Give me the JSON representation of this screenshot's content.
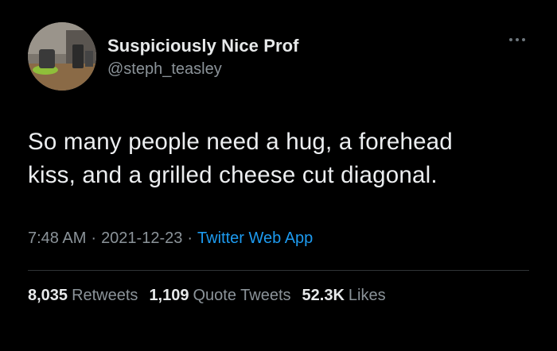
{
  "author": {
    "display_name": "Suspiciously Nice Prof",
    "handle": "@steph_teasley"
  },
  "tweet": {
    "text_lines": [
      "So many people need a hug, a forehead",
      "kiss, and a grilled cheese cut diagonal."
    ],
    "time": "7:48 AM",
    "date": "2021-12-23",
    "separator": "·",
    "source": "Twitter Web App"
  },
  "stats": {
    "retweets": {
      "count": "8,035",
      "label": "Retweets"
    },
    "quotes": {
      "count": "1,109",
      "label": "Quote Tweets"
    },
    "likes": {
      "count": "52.3K",
      "label": "Likes"
    }
  },
  "icons": {
    "more": "more-horizontal-icon"
  },
  "colors": {
    "background": "#000000",
    "text_primary": "#e7e9ea",
    "text_secondary": "#8b9399",
    "link": "#1d9bf0",
    "divider": "#2f3336"
  }
}
